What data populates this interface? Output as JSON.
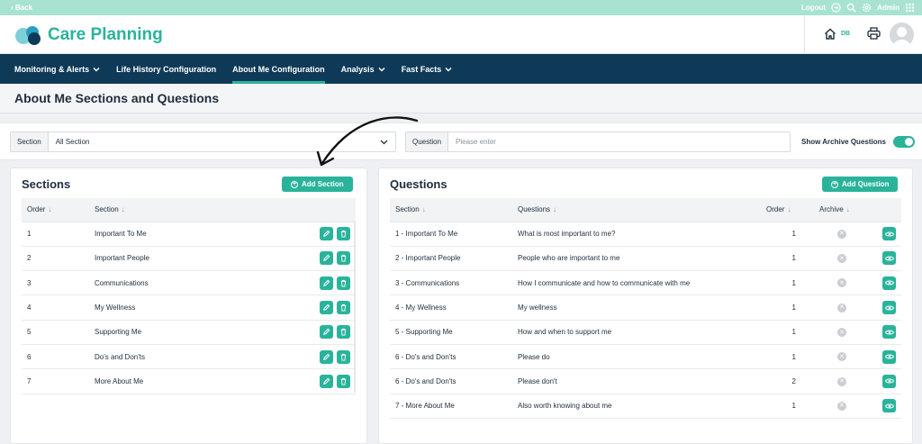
{
  "topbar": {
    "back": "‹ Back",
    "logout": "Logout",
    "user": "Admin"
  },
  "header": {
    "brand": "Care Planning",
    "home_badge": "DB"
  },
  "nav": {
    "items": [
      {
        "label": "Monitoring & Alerts",
        "dropdown": true
      },
      {
        "label": "Life History Configuration",
        "dropdown": false
      },
      {
        "label": "About Me Configuration",
        "dropdown": false,
        "active": true
      },
      {
        "label": "Analysis",
        "dropdown": true
      },
      {
        "label": "Fast Facts",
        "dropdown": true
      }
    ]
  },
  "page": {
    "title": "About Me Sections and Questions"
  },
  "filters": {
    "section_label": "Section",
    "section_value": "All Section",
    "question_label": "Question",
    "question_placeholder": "Please enter",
    "archive_label": "Show Archive Questions",
    "archive_on": true
  },
  "sections": {
    "title": "Sections",
    "add_label": "Add Section",
    "columns": [
      "Order",
      "Section"
    ],
    "rows": [
      {
        "order": "1",
        "section": "Important To Me"
      },
      {
        "order": "2",
        "section": "Important People"
      },
      {
        "order": "3",
        "section": "Communications"
      },
      {
        "order": "4",
        "section": "My Wellness"
      },
      {
        "order": "5",
        "section": "Supporting Me"
      },
      {
        "order": "6",
        "section": "Do's and Don'ts"
      },
      {
        "order": "7",
        "section": "More About Me"
      }
    ]
  },
  "questions": {
    "title": "Questions",
    "add_label": "Add Question",
    "columns": [
      "Section",
      "Questions",
      "Order",
      "Archive"
    ],
    "rows": [
      {
        "section": "1 - Important To Me",
        "question": "What is most important to me?",
        "order": "1"
      },
      {
        "section": "2 - Important People",
        "question": "People who are important to me",
        "order": "1"
      },
      {
        "section": "3 - Communications",
        "question": "How I communicate and how to communicate with me",
        "order": "1"
      },
      {
        "section": "4 - My Wellness",
        "question": "My wellness",
        "order": "1"
      },
      {
        "section": "5 - Supporting Me",
        "question": "How and when to support me",
        "order": "1"
      },
      {
        "section": "6 - Do's and Don'ts",
        "question": "Please do",
        "order": "1"
      },
      {
        "section": "6 - Do's and Don'ts",
        "question": "Please don't",
        "order": "2"
      },
      {
        "section": "7 - More About Me",
        "question": "Also worth knowing about me",
        "order": "1"
      }
    ]
  },
  "colors": {
    "accent": "#2ab39b",
    "nav_bg": "#0e3a58",
    "topbar_bg": "#a8e3d2"
  }
}
